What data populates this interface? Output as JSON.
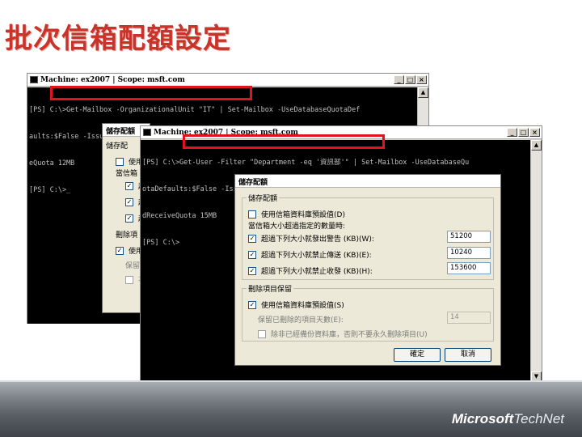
{
  "slide": {
    "title": "批次信箱配額設定"
  },
  "window1": {
    "title": "Machine: ex2007 | Scope: msft.com",
    "lines": [
      "[PS] C:\\>Get-Mailbox -OrganizationalUnit \"IT\" | Set-Mailbox -UseDatabaseQuotaDef",
      "aults:$False -IssueWarningQuota 7MB -ProhibitSendQuota 7MB -ProhibitSendReceiv",
      "eQuota 12MB",
      "[PS] C:\\>_"
    ]
  },
  "dialog_back": {
    "title": "儲存配額",
    "rows": [
      "儲存配",
      "使用",
      "當信箱",
      "超",
      "超",
      "超",
      "刪除項",
      "使用",
      "保留",
      "不"
    ]
  },
  "window2": {
    "title": "Machine: ex2007 | Scope: msft.com",
    "lines": [
      "[PS] C:\\>Get-User -Filter \"Department -eq '資訊部'\" | Set-Mailbox -UseDatabaseQu",
      "otaDefaults:$False -IssueWarningQuota 10MB -ProhibitSendQuota 10MB -ProhibitSen",
      "dReceiveQuota 15MB",
      "[PS] C:\\>"
    ]
  },
  "dialog": {
    "title": "儲存配額",
    "storage_group": "儲存配額",
    "use_db_defaults": "使用信箱資料庫預設值(D)",
    "when_exceeds": "當信箱大小超過指定的數量時:",
    "issue_warning": "超過下列大小就發出警告 (KB)(W):",
    "issue_warning_value": "51200",
    "prohibit_send": "超過下列大小就禁止傳送 (KB)(E):",
    "prohibit_send_value": "10240",
    "prohibit_send_receive": "超過下列大小就禁止收發 (KB)(H):",
    "prohibit_send_receive_value": "153600",
    "deleted_group": "刪除項目保留",
    "use_db_defaults_2": "使用信箱資料庫預設值(S)",
    "keep_days": "保留已刪除的項目天數(E):",
    "keep_days_value": "14",
    "no_delete": "除非已經備份資料庫，否則不要永久刪除項目(U)",
    "ok": "確定",
    "cancel": "取消"
  },
  "footer": {
    "logo_a": "Microsoft",
    "logo_b": "TechNet"
  }
}
